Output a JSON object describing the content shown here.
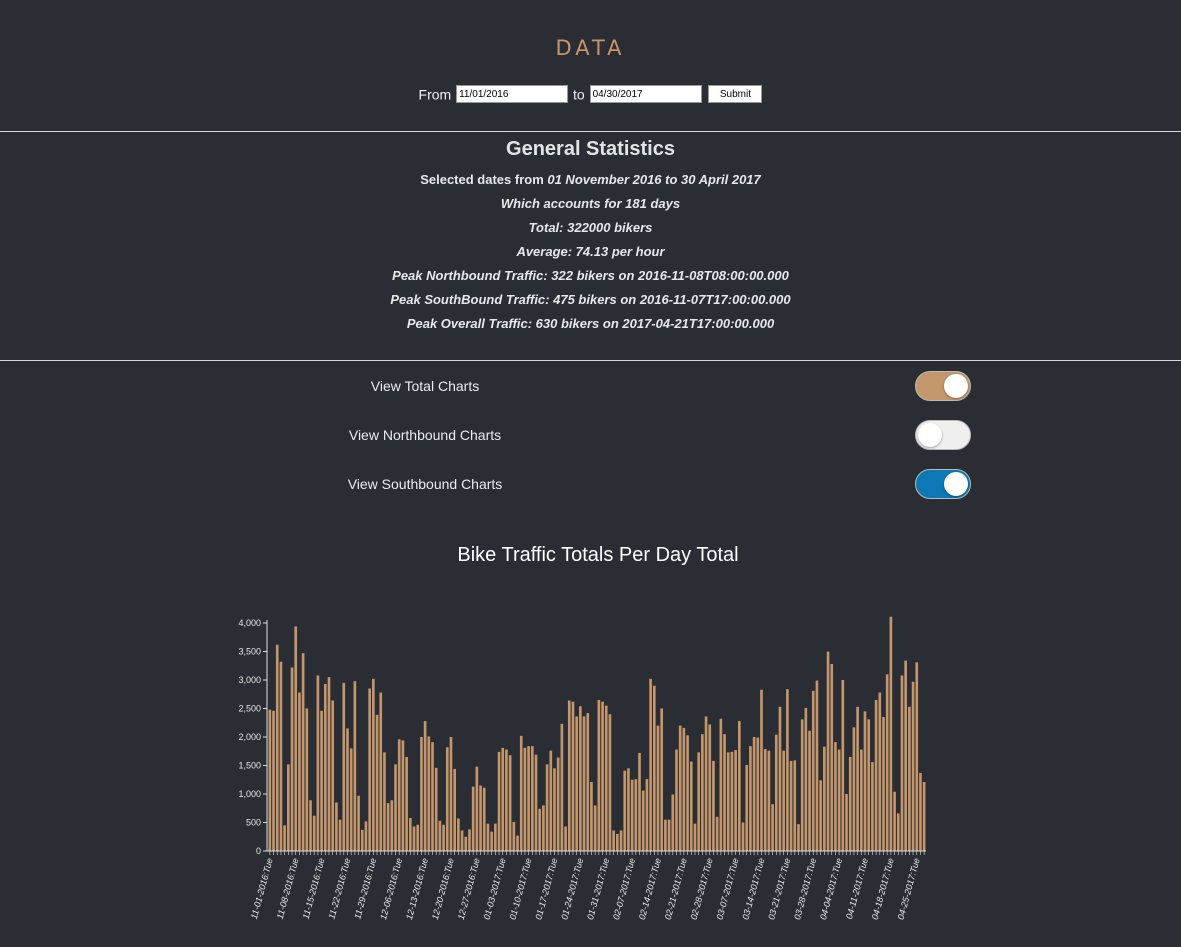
{
  "header": {
    "title": "DATA",
    "from_label": "From",
    "to_label": "to",
    "from_value": "11/01/2016",
    "to_value": "04/30/2017",
    "submit_label": "Submit"
  },
  "stats": {
    "title": "General Statistics",
    "line1_prefix": "Selected dates from ",
    "line1_range": "01 November 2016 to 30 April 2017",
    "line2": "Which accounts for 181 days",
    "line3": "Total: 322000 bikers",
    "line4": "Average: 74.13 per hour",
    "line5": "Peak Northbound Traffic: 322 bikers on 2016-11-08T08:00:00.000",
    "line6": "Peak SouthBound Traffic: 475 bikers on 2016-11-07T17:00:00.000",
    "line7": "Peak Overall Traffic: 630 bikers on 2017-04-21T17:00:00.000"
  },
  "toggles": [
    {
      "label": "View Total Charts",
      "on": true,
      "color": "#c4966b"
    },
    {
      "label": "View Northbound Charts",
      "on": false,
      "color": "#efefef"
    },
    {
      "label": "View Southbound Charts",
      "on": true,
      "color": "#0c78b5"
    }
  ],
  "colors": {
    "background": "#2a2d34",
    "accent": "#c8956a",
    "bar": "#c4966b"
  },
  "chart_data": {
    "type": "bar",
    "title": "Bike Traffic Totals Per Day Total",
    "ylim": [
      0,
      4000
    ],
    "yticks": [
      "0",
      "500",
      "1,000",
      "1,500",
      "2,000",
      "2,500",
      "3,000",
      "3,500",
      "4,000"
    ],
    "xtick_labels": [
      "11-01-2016:Tue",
      "11-08-2016:Tue",
      "11-15-2016:Tue",
      "11-22-2016:Tue",
      "11-29-2016:Tue",
      "12-06-2016:Tue",
      "12-13-2016:Tue",
      "12-20-2016:Tue",
      "12-27-2016:Tue",
      "01-03-2017:Tue",
      "01-10-2017:Tue",
      "01-17-2017:Tue",
      "01-24-2017:Tue",
      "01-31-2017:Tue",
      "02-07-2017:Tue",
      "02-14-2017:Tue",
      "02-21-2017:Tue",
      "02-28-2017:Tue",
      "03-07-2017:Tue",
      "03-14-2017:Tue",
      "03-21-2017:Tue",
      "03-28-2017:Tue",
      "04-04-2017:Tue",
      "04-11-2017:Tue",
      "04-18-2017:Tue",
      "04-25-2017:Tue"
    ],
    "values": [
      2480,
      2460,
      3620,
      3320,
      450,
      1520,
      3220,
      3940,
      2780,
      3470,
      2500,
      890,
      620,
      3080,
      2460,
      2930,
      3050,
      2640,
      850,
      550,
      2950,
      2150,
      1800,
      2980,
      970,
      370,
      520,
      2850,
      3020,
      2390,
      2780,
      1730,
      840,
      890,
      1520,
      1960,
      1940,
      1650,
      580,
      430,
      460,
      2000,
      2280,
      2010,
      1910,
      1460,
      530,
      460,
      1820,
      2000,
      1440,
      570,
      360,
      250,
      380,
      1130,
      1480,
      1150,
      1110,
      480,
      340,
      480,
      1740,
      1810,
      1780,
      1680,
      510,
      270,
      2020,
      1810,
      1840,
      1840,
      1690,
      740,
      800,
      1520,
      1760,
      1450,
      1640,
      2230,
      430,
      2640,
      2620,
      2360,
      2540,
      2360,
      2420,
      1210,
      800,
      2650,
      2620,
      2550,
      2400,
      360,
      300,
      360,
      1410,
      1450,
      1250,
      1260,
      1720,
      1060,
      1260,
      3020,
      2900,
      2200,
      2500,
      550,
      550,
      990,
      1780,
      2200,
      2160,
      2030,
      1570,
      480,
      1730,
      2050,
      2360,
      2220,
      1580,
      600,
      2320,
      2050,
      1730,
      1740,
      1770,
      2280,
      500,
      1510,
      1840,
      2000,
      1990,
      2830,
      1790,
      1760,
      820,
      2040,
      2530,
      1760,
      2840,
      1580,
      1590,
      470,
      2310,
      2510,
      2110,
      2810,
      2990,
      1240,
      1830,
      3500,
      3280,
      1910,
      1780,
      3000,
      1000,
      1650,
      2170,
      2530,
      1780,
      2450,
      2310,
      1560,
      2650,
      2780,
      2350,
      3100,
      4110,
      1040,
      660,
      3080,
      3340,
      2530,
      2970,
      3310,
      1370,
      1210
    ]
  }
}
